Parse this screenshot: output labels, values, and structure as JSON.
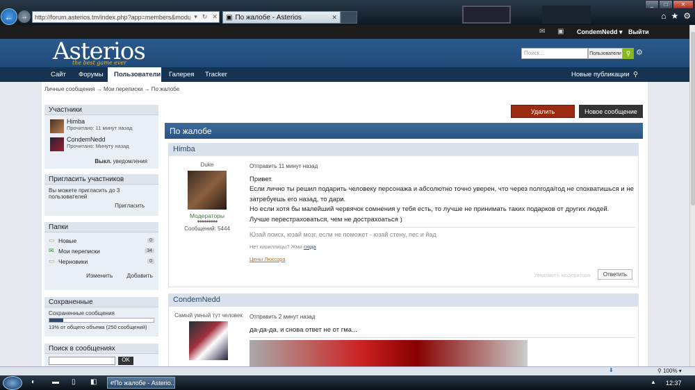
{
  "browser": {
    "url": "http://forum.asterios.tm/index.php?app=members&module=mess",
    "tab_title": "По жалобе - Asterios",
    "zoom": "100%"
  },
  "topbar": {
    "username": "CondemNedd",
    "logout": "Выйти"
  },
  "header": {
    "logo": "Asterios",
    "tagline": "the best game ever",
    "search_placeholder": "Поиск...",
    "search_scope": "Пользователи"
  },
  "nav": {
    "items": [
      "Сайт",
      "Форумы",
      "Пользователи",
      "Галерея",
      "Tracker"
    ],
    "active": "Пользователи",
    "new_content": "Новые публикации"
  },
  "breadcrumb": [
    "Личные сообщения",
    "Мои переписки",
    "По жалобе"
  ],
  "sidebar": {
    "participants": {
      "title": "Участники",
      "items": [
        {
          "name": "Himba",
          "status": "Прочитано: 11 минут назад"
        },
        {
          "name": "CondemNedd",
          "status": "Прочитано: Минуту назад"
        }
      ],
      "notify_off": "Выкл.",
      "notify_label": "уведомления"
    },
    "invite": {
      "title": "Пригласить участников",
      "text": "Вы можете пригласить до 3 пользователей",
      "button": "Пригласить"
    },
    "folders": {
      "title": "Папки",
      "items": [
        {
          "name": "Новые",
          "count": "0"
        },
        {
          "name": "Мои переписки",
          "count": "34"
        },
        {
          "name": "Черновики",
          "count": "0"
        }
      ],
      "edit": "Изменить",
      "add": "Добавить"
    },
    "saved": {
      "title": "Сохраненные",
      "label": "Сохраненные сообщения",
      "usage": "13% от общего объема (250 сообщений)",
      "fraction": 0.13
    },
    "search": {
      "title": "Поиск в сообщениях",
      "button": "OK"
    }
  },
  "main": {
    "delete_button": "Удалить",
    "new_message_button": "Новое сообщение",
    "title": "По жалобе",
    "posts": [
      {
        "author": "Himba",
        "user_title": "Duke",
        "group": "Модераторы",
        "pips": "●●●●●●●●●",
        "post_count": "Сообщений: 5444",
        "sent": "Отправить 11 минут назад",
        "lines": [
          "Привет.",
          "Если лично ты решил подарить человеку персонажа и абсолютно точно уверен, что через полгода/год не спохватишься и не",
          "затребуешь его назад, то дари.",
          "Но если хотя бы малейший червячок сомнения у тебя есть, то лучше не принимать таких подарков от других людей.",
          "Лучше перестраховаться, чем не дострахоаться )"
        ],
        "sig1": "Юзай поиск, юзай мозг, если не поможет - юзай стену, пес и йад",
        "sig2_prefix": "Нет кириллицы? Жми ",
        "sig2_link": "сюда",
        "sig3": "Цены Люксора",
        "report": "Уведомить модератора",
        "reply": "Ответить"
      },
      {
        "author": "CondemNedd",
        "user_title": "Самый умный тут человек",
        "sent": "Отправить 2 минут назад",
        "lines": [
          "да-да-да, и снова ответ не от гма..."
        ]
      }
    ]
  },
  "taskbar": {
    "task": "По жалобе - Asterio...",
    "clock": "12:37"
  }
}
